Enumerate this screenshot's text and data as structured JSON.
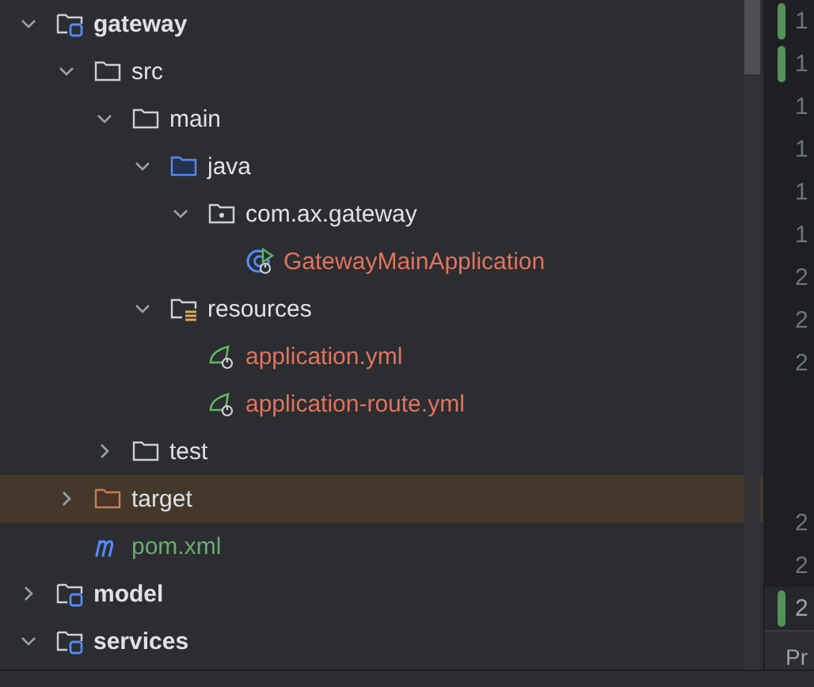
{
  "project_tree": [
    {
      "name": "gateway",
      "kind": "module",
      "expanded": true,
      "selected": false,
      "children": [
        {
          "name": "src",
          "kind": "folder",
          "expanded": true,
          "selected": false,
          "children": [
            {
              "name": "main",
              "kind": "folder",
              "expanded": true,
              "selected": false,
              "children": [
                {
                  "name": "java",
                  "kind": "source_folder",
                  "expanded": true,
                  "selected": false,
                  "children": [
                    {
                      "name": "com.ax.gateway",
                      "kind": "package",
                      "expanded": true,
                      "selected": false,
                      "children": [
                        {
                          "name": "GatewayMainApplication",
                          "kind": "spring_boot_class",
                          "color": "#e0735e",
                          "selected": false
                        }
                      ]
                    }
                  ]
                },
                {
                  "name": "resources",
                  "kind": "resources_folder",
                  "expanded": true,
                  "selected": false,
                  "children": [
                    {
                      "name": "application.yml",
                      "kind": "spring_config",
                      "color": "#e0735e",
                      "selected": false
                    },
                    {
                      "name": "application-route.yml",
                      "kind": "spring_config",
                      "color": "#e0735e",
                      "selected": false
                    }
                  ]
                }
              ]
            },
            {
              "name": "test",
              "kind": "folder",
              "expanded": false,
              "selected": false
            }
          ]
        },
        {
          "name": "target",
          "kind": "excluded_folder",
          "expanded": false,
          "selected": true
        },
        {
          "name": "pom.xml",
          "kind": "maven",
          "color": "#6aab73",
          "selected": false
        }
      ]
    },
    {
      "name": "model",
      "kind": "module",
      "expanded": false,
      "selected": false
    },
    {
      "name": "services",
      "kind": "module",
      "expanded": true,
      "selected": false
    }
  ],
  "editor_gutter": [
    {
      "kind": "line",
      "number": "1",
      "changed": true,
      "current": false
    },
    {
      "kind": "line",
      "number": "1",
      "changed": true,
      "current": false
    },
    {
      "kind": "line",
      "number": "1",
      "changed": false,
      "current": false
    },
    {
      "kind": "line",
      "number": "1",
      "changed": false,
      "current": false
    },
    {
      "kind": "line",
      "number": "1",
      "changed": false,
      "current": false
    },
    {
      "kind": "line",
      "number": "1",
      "changed": false,
      "current": false
    },
    {
      "kind": "line",
      "number": "2",
      "changed": false,
      "current": false
    },
    {
      "kind": "line",
      "number": "2",
      "changed": false,
      "current": false
    },
    {
      "kind": "line",
      "number": "2",
      "changed": false,
      "current": false
    },
    {
      "kind": "inlay"
    },
    {
      "kind": "line",
      "number": "2",
      "changed": false,
      "current": false
    },
    {
      "kind": "line",
      "number": "2",
      "changed": false,
      "current": false
    },
    {
      "kind": "line",
      "number": "2",
      "changed": true,
      "current": true
    }
  ],
  "bottom_tab": {
    "label": "Pr"
  }
}
